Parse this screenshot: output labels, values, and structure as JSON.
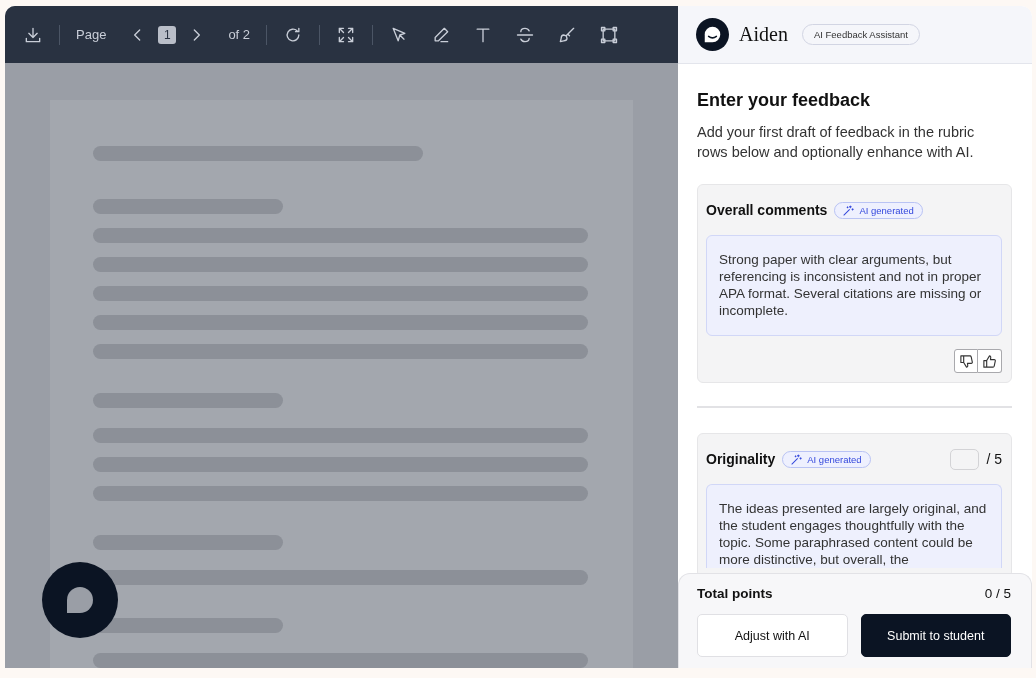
{
  "toolbar": {
    "page_label": "Page",
    "page_number": "1",
    "page_total": "of 2"
  },
  "assistant": {
    "name": "Aiden",
    "badge": "AI Feedback Assistant"
  },
  "heading": "Enter your feedback",
  "description": "Add your first draft of feedback in the rubric rows below and optionally enhance with AI.",
  "rubric_rows": [
    {
      "kind": "comment",
      "title": "Overall comments",
      "badge": "AI generated",
      "comment": "Strong paper with clear arguments, but referencing is inconsistent and not in proper APA format. Several citations are missing or incomplete."
    },
    {
      "kind": "scored",
      "title": "Originality",
      "badge": "AI generated",
      "score_suffix": "/ 5",
      "comment": "The ideas presented are largely original, and the student engages thoughtfully with the topic. Some paraphrased content could be more distinctive, but overall, the"
    }
  ],
  "footer": {
    "label": "Total points",
    "value": "0 / 5",
    "buttons": [
      {
        "kind": "secondary",
        "label": "Adjust with AI"
      },
      {
        "kind": "primary",
        "label": "Submit to student"
      }
    ]
  }
}
